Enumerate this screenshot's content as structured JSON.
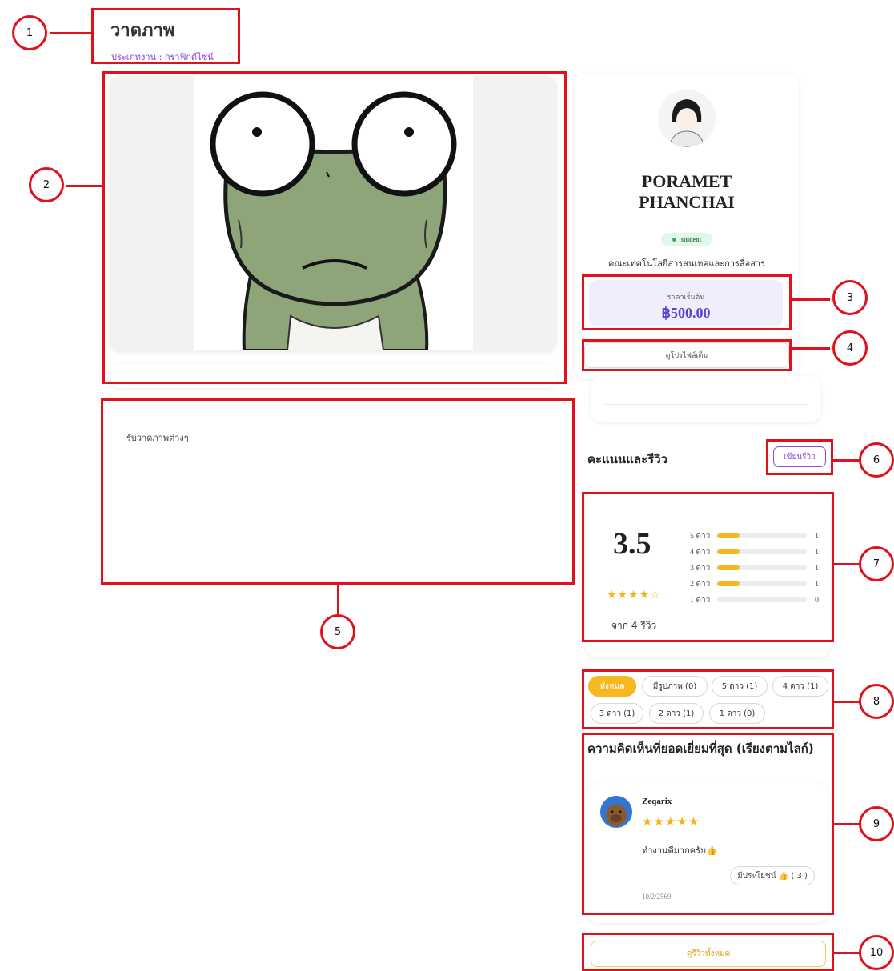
{
  "callouts": [
    "1",
    "2",
    "3",
    "4",
    "5",
    "6",
    "7",
    "8",
    "9",
    "10"
  ],
  "header": {
    "title": "วาดภาพ",
    "category": "ประเภทงาน : กราฟิกดีไซน์"
  },
  "profile": {
    "name_line1": "PORAMET",
    "name_line2": "PHANCHAI",
    "badge": "student",
    "faculty": "คณะเทคโนโลยีสารสนเทศและการสื่อสาร",
    "price_label": "ราคาเริ่มต้น",
    "price": "฿500.00",
    "view_profile": "ดูโปรไฟล์เต็ม"
  },
  "description": "รับวาดภาพต่างๆ",
  "reviews": {
    "heading": "คะแนนและรีวิว",
    "write_review": "เขียนรีวิว",
    "average": "3.5",
    "stars_display": "★★★★☆",
    "total_text": "จาก 4 รีวิว",
    "breakdown": [
      {
        "label": "5 ดาว",
        "count": "1",
        "fraction": 0.25
      },
      {
        "label": "4 ดาว",
        "count": "1",
        "fraction": 0.25
      },
      {
        "label": "3 ดาว",
        "count": "1",
        "fraction": 0.25
      },
      {
        "label": "2 ดาว",
        "count": "1",
        "fraction": 0.25
      },
      {
        "label": "1 ดาว",
        "count": "0",
        "fraction": 0
      }
    ],
    "filters": [
      "ทั้งหมด",
      "มีรูปภาพ (0)",
      "5 ดาว (1)",
      "4 ดาว (1)",
      "3 ดาว (1)",
      "2 ดาว (1)",
      "1 ดาว (0)"
    ],
    "top_heading": "ความคิดเห็นที่ยอดเยี่ยมที่สุด (เรียงตามไลก์)",
    "top_review": {
      "user": "Zeqarix",
      "stars": "★★★★★",
      "text": "ทำงานดีมากครับ👍",
      "helpful": "มีประโยชน์ 👍 ( 3 )",
      "date": "10/2/2569"
    },
    "see_all": "ดูรีวิวทั้งหมด"
  },
  "colors": {
    "accent": "#f6b820",
    "price": "#5b3fd2",
    "annotation": "#e0111b"
  }
}
